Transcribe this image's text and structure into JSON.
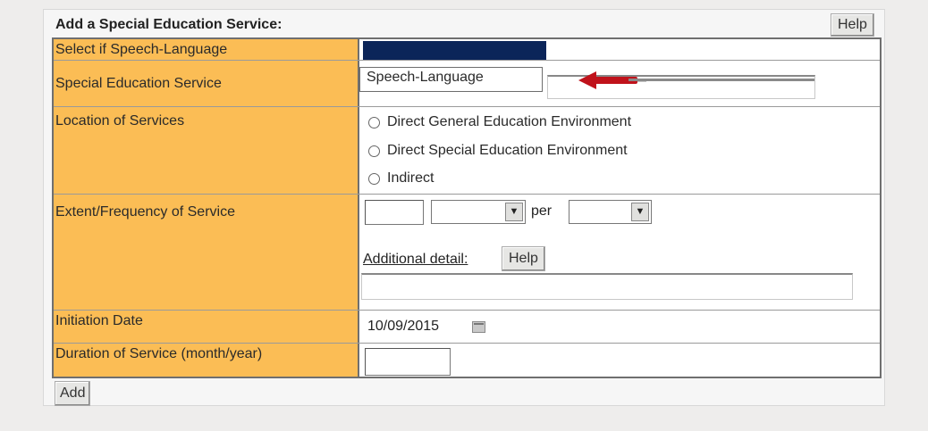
{
  "header": {
    "title": "Add a Special Education Service:",
    "help_label": "Help"
  },
  "rows": {
    "speech": {
      "label": "Select if Speech-Language"
    },
    "service": {
      "label": "Special Education Service",
      "dropdown_option": "Speech-Language"
    },
    "location": {
      "label": "Location of Services",
      "options": [
        "Direct General Education Environment",
        "Direct Special Education Environment",
        "Indirect"
      ]
    },
    "extent": {
      "label": "Extent/Frequency of Service",
      "per_label": "per",
      "additional_detail": "Additional detail:",
      "help_label": "Help"
    },
    "initiation": {
      "label": "Initiation Date",
      "date_value": "10/09/2015"
    },
    "duration": {
      "label": "Duration of Service (month/year)"
    }
  },
  "footer": {
    "add_label": "Add"
  },
  "colors": {
    "label_bg": "#fbbd55",
    "selection_bg": "#0b2559",
    "arrow": "#c0121b",
    "border": "#6f6f6f"
  },
  "icons": {
    "arrow": "left-arrow-icon",
    "calendar": "calendar-icon",
    "dropdown": "chevron-down-icon"
  }
}
